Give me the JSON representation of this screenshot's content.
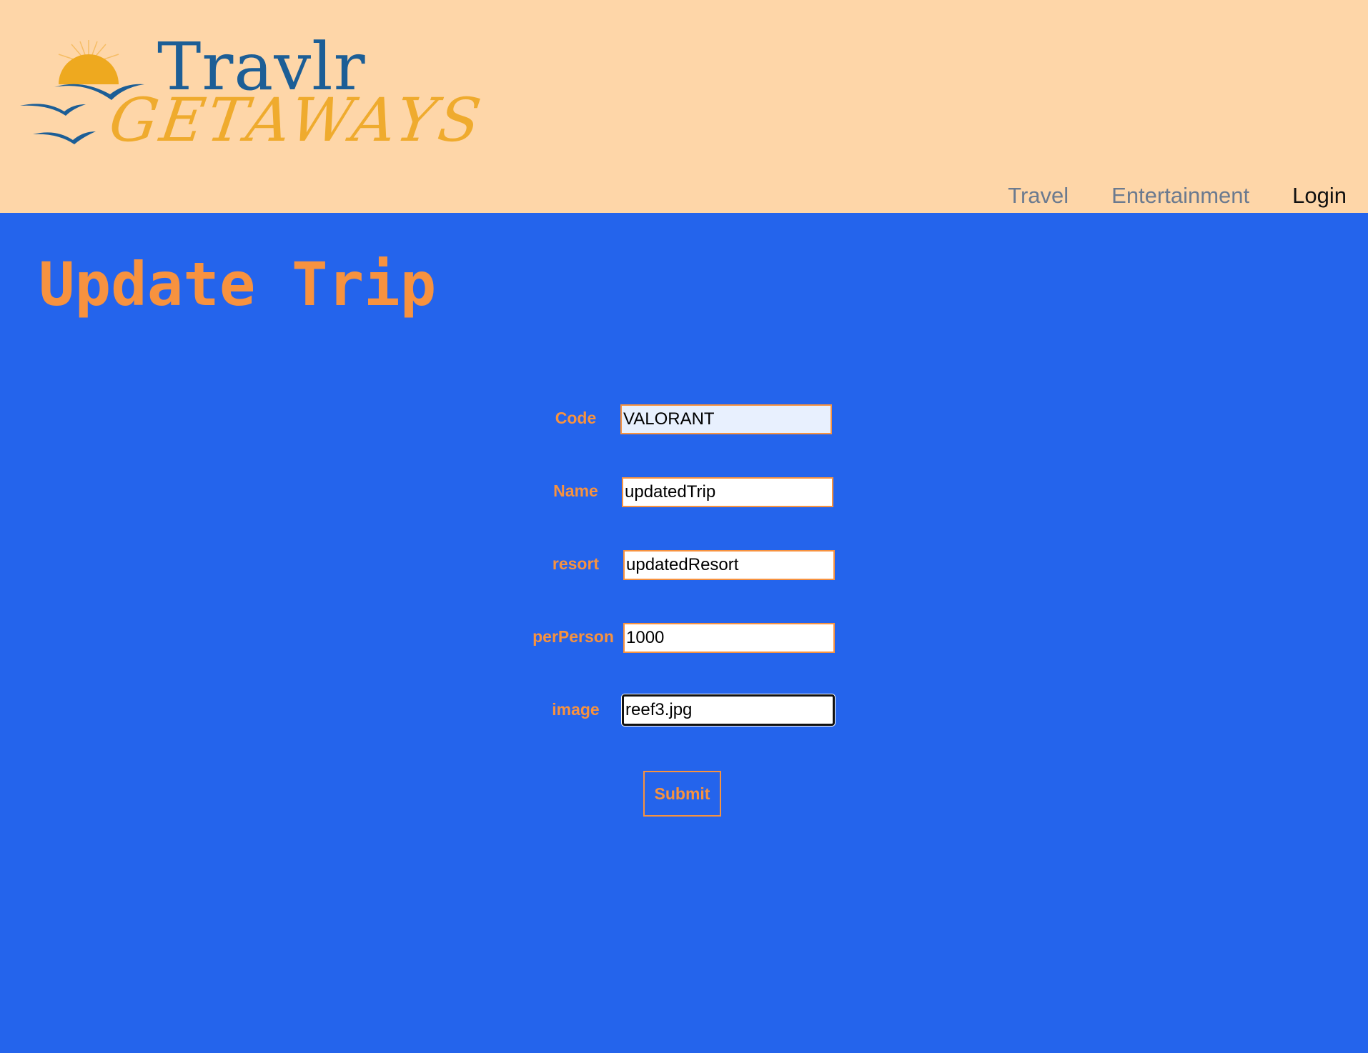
{
  "header": {
    "logo": {
      "word_top": "Travlr",
      "word_bottom": "GETAWAYS"
    },
    "nav": [
      {
        "label": "Travel",
        "active": false
      },
      {
        "label": "Entertainment",
        "active": false
      },
      {
        "label": "Login",
        "active": true
      }
    ]
  },
  "page": {
    "title": "Update Trip"
  },
  "form": {
    "fields": [
      {
        "label": "Code",
        "value": "VALORANT"
      },
      {
        "label": "Name",
        "value": "updatedTrip"
      },
      {
        "label": "resort",
        "value": "updatedResort"
      },
      {
        "label": "perPerson",
        "value": "1000"
      },
      {
        "label": "image",
        "value": "reef3.jpg"
      }
    ],
    "submit_label": "Submit"
  },
  "colors": {
    "header_bg": "#fed6a8",
    "page_bg": "#2464ec",
    "accent": "#f7923f",
    "logo_blue": "#1c5e96",
    "logo_gold": "#efab2e"
  }
}
